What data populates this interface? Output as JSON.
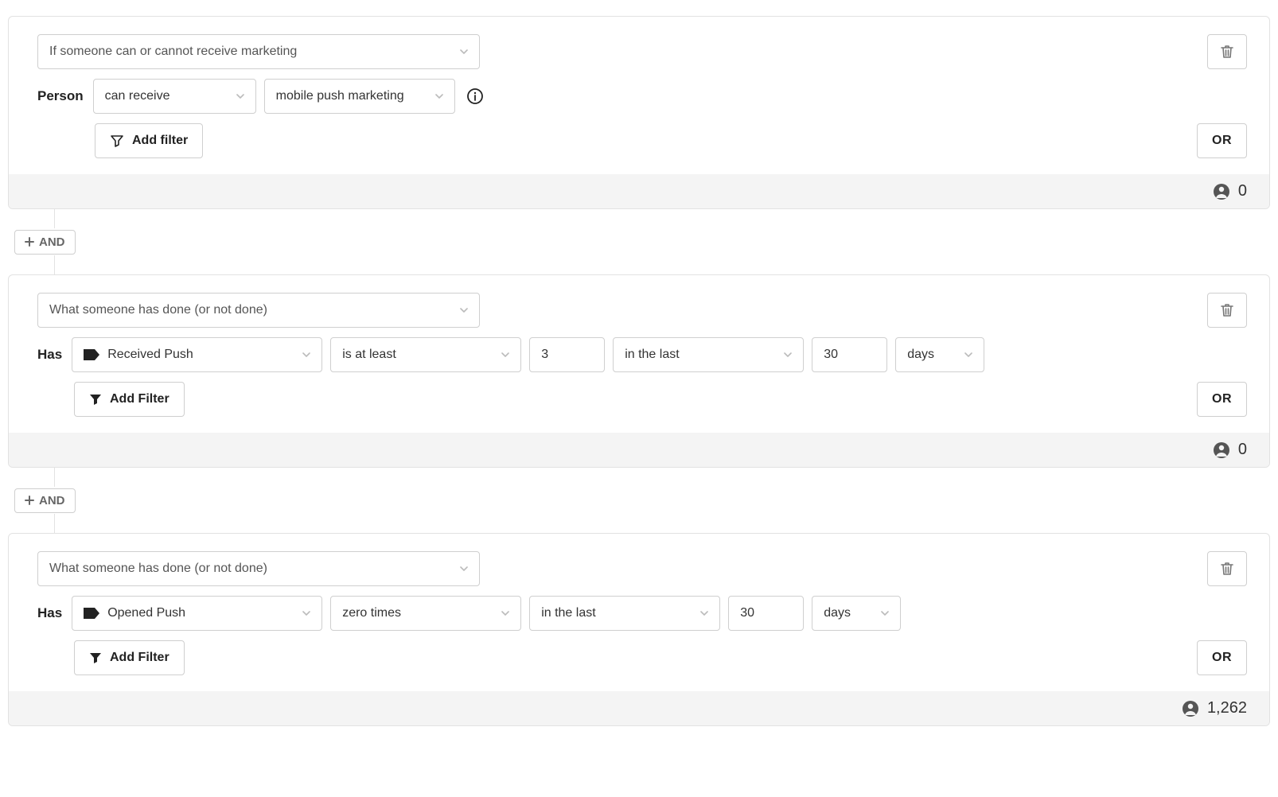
{
  "buttons": {
    "add_filter": "Add filter",
    "add_filter2": "Add Filter",
    "or": "OR",
    "and": "AND"
  },
  "blocks": [
    {
      "type_label": "If someone can or cannot receive marketing",
      "person_label": "Person",
      "can_receive": "can receive",
      "channel": "mobile push marketing",
      "count": "0"
    },
    {
      "type_label": "What someone has done (or not done)",
      "has_label": "Has",
      "event": "Received Push",
      "op": "is at least",
      "value": "3",
      "range": "in the last",
      "range_val": "30",
      "unit": "days",
      "count": "0"
    },
    {
      "type_label": "What someone has done (or not done)",
      "has_label": "Has",
      "event": "Opened Push",
      "op": "zero times",
      "range": "in the last",
      "range_val": "30",
      "unit": "days",
      "count": "1,262"
    }
  ]
}
